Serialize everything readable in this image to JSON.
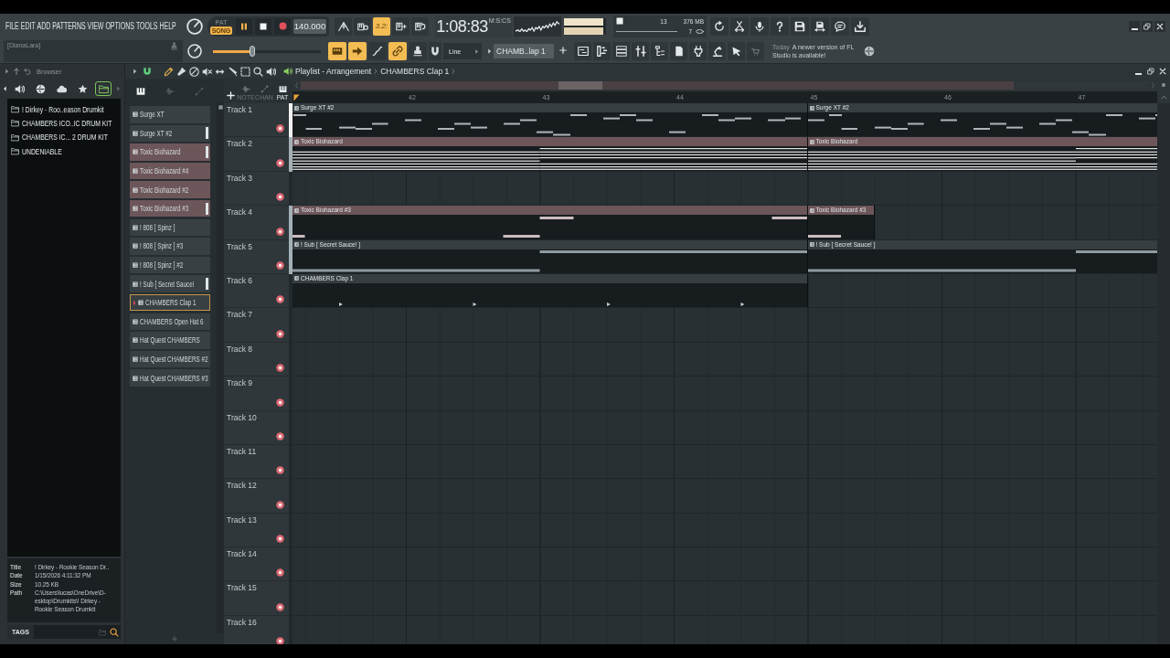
{
  "menu": [
    "FILE",
    "EDIT",
    "ADD",
    "PATTERNS",
    "VIEW",
    "OPTIONS",
    "TOOLS",
    "HELP"
  ],
  "transport": {
    "modes": [
      {
        "label": "PAT",
        "selected": false
      },
      {
        "label": "SONG",
        "selected": true
      }
    ],
    "tempo": "140.000"
  },
  "record_toggles": [
    {
      "on": false
    },
    {
      "on": false
    },
    {
      "on": true,
      "label": "3.2:"
    },
    {
      "on": false
    },
    {
      "on": false
    }
  ],
  "time": {
    "value": "1:08:83",
    "unit": "M:S:CS"
  },
  "output_meter": {
    "level": 0.94
  },
  "monitor": {
    "cpu": "13",
    "memory": "376 MB",
    "polyphony": "7"
  },
  "hint": "[DianaLara]",
  "main_slider": {
    "level": 0.36
  },
  "edit_toggles": [
    {
      "on": true
    },
    {
      "on": true
    },
    {
      "on": false
    },
    {
      "on": true
    },
    {
      "on": false
    },
    {
      "on": false
    }
  ],
  "snap": "Line",
  "pattern_selector": "CHAMB..lap 1",
  "news": {
    "date": "Today",
    "message": "A newer version of FL Studio is available!"
  },
  "browser": {
    "title": "Browser",
    "tabs": [
      {
        "selected": false
      },
      {
        "selected": false
      },
      {
        "selected": false
      },
      {
        "selected": false
      },
      {
        "selected": true
      }
    ],
    "folders": [
      "! Dirkey - Roo..eason Drumkit",
      "CHAMBERS ICO..IC DRUM KIT",
      "CHAMBERS IC... 2 DRUM KIT",
      "UNDENIABLE"
    ],
    "info": [
      {
        "label": "Title",
        "value": "! Dirkey - Rookie Season Dr.."
      },
      {
        "label": "Date",
        "value": "1/15/2026 4:11:32 PM"
      },
      {
        "label": "Size",
        "value": "10.25 KB"
      },
      {
        "label": "Path",
        "value": "C:\\Users\\lucas\\OneDrive\\D-\nesktop\\Drumkits\\! Dirkey -\nRookie Season Drumkit"
      }
    ],
    "tags": "TAGS"
  },
  "playlist": {
    "title": "Playlist - Arrangement",
    "current_pattern": "CHAMBERS Clap 1",
    "picker_tabs": [
      {
        "label": "NOTE",
        "selected": false
      },
      {
        "label": "CHAN",
        "selected": false
      },
      {
        "label": "PAT",
        "selected": true
      }
    ],
    "patterns": [
      {
        "name": "Surge XT",
        "color": "#394044",
        "selected": false,
        "flagged": false
      },
      {
        "name": "Surge XT #2",
        "color": "#394044",
        "selected": false,
        "flagged": true
      },
      {
        "name": "Toxic Biohazard",
        "color": "#6c5659",
        "selected": false,
        "flagged": true
      },
      {
        "name": "Toxic Biohazard #4",
        "color": "#6c5659",
        "selected": false,
        "flagged": false
      },
      {
        "name": "Toxic Biohazard #2",
        "color": "#6c5659",
        "selected": false,
        "flagged": false
      },
      {
        "name": "Toxic Biohazard #3",
        "color": "#6c5659",
        "selected": false,
        "flagged": true
      },
      {
        "name": "! 808 [ Spinz ]",
        "color": "#394044",
        "selected": false,
        "flagged": false
      },
      {
        "name": "! 808 [ Spinz ] #3",
        "color": "#394044",
        "selected": false,
        "flagged": false
      },
      {
        "name": "! 808 [ Spinz ] #2",
        "color": "#394044",
        "selected": false,
        "flagged": false
      },
      {
        "name": "! Sub [ Secret Sauce!",
        "color": "#394044",
        "selected": false,
        "flagged": true
      },
      {
        "name": "CHAMBERS Clap 1",
        "color": "#394044",
        "selected": true,
        "flagged": false
      },
      {
        "name": "CHAMBERS Open Hat 6",
        "color": "#394044",
        "selected": false,
        "flagged": false
      },
      {
        "name": "Hat Quest CHAMBERS",
        "color": "#394044",
        "selected": false,
        "flagged": false
      },
      {
        "name": "Hat Quest CHAMBERS #2",
        "color": "#394044",
        "selected": false,
        "flagged": false
      },
      {
        "name": "Hat Quest CHAMBERS #3",
        "color": "#394044",
        "selected": false,
        "flagged": false
      }
    ],
    "ruler": [
      "42",
      "43",
      "44",
      "45",
      "46",
      "47"
    ],
    "tracks": [
      {
        "name": "Track 1",
        "on": true,
        "color": "#f2f2f2",
        "clips": [
          {
            "name": "Surge XT #2",
            "kind": "melody",
            "color": "#363e42",
            "cut_left": true,
            "cut_right": false
          },
          {
            "name": "Surge XT #2",
            "kind": "melody",
            "color": "#363e42",
            "cut_left": false,
            "cut_right": true
          }
        ]
      },
      {
        "name": "Track 2",
        "on": true,
        "color": "#a3b0b6",
        "clips": [
          {
            "name": "Toxic Biohazard",
            "kind": "chords",
            "color": "#6c5659",
            "cut_left": true,
            "cut_right": false
          },
          {
            "name": "Toxic Biohazard",
            "kind": "chords",
            "color": "#6c5659",
            "cut_left": false,
            "cut_right": true
          }
        ]
      },
      {
        "name": "Track 3",
        "on": true
      },
      {
        "name": "Track 4",
        "on": true,
        "color": "#a3b0b6",
        "clips": [
          {
            "name": "Toxic Biohazard #3",
            "kind": "blocks",
            "color": "#6c5659",
            "cut_left": true,
            "cut_right": false
          },
          {
            "name": "Toxic Biohazard #3",
            "kind": "blocks",
            "color": "#6c5659",
            "cut_left": false,
            "cut_right": false
          }
        ]
      },
      {
        "name": "Track 5",
        "on": true,
        "color": "#a3b0b6",
        "clips": [
          {
            "name": "! Sub [ Secret Sauce! ]",
            "kind": "bass",
            "color": "#363e42",
            "cut_left": true,
            "cut_right": false
          },
          {
            "name": "! Sub [ Secret Sauce! ]",
            "kind": "bass",
            "color": "#363e42",
            "cut_left": false,
            "cut_right": true
          }
        ]
      },
      {
        "name": "Track 6",
        "on": true,
        "clips": [
          {
            "name": "CHAMBERS Clap 1",
            "kind": "hits",
            "color": "#363e42",
            "cut_left": true,
            "cut_right": false
          }
        ]
      },
      {
        "name": "Track 7",
        "on": true
      },
      {
        "name": "Track 8",
        "on": true
      },
      {
        "name": "Track 9",
        "on": true
      },
      {
        "name": "Track 10",
        "on": true
      },
      {
        "name": "Track 11",
        "on": true
      },
      {
        "name": "Track 12",
        "on": true
      },
      {
        "name": "Track 13",
        "on": true
      },
      {
        "name": "Track 14",
        "on": true
      },
      {
        "name": "Track 15",
        "on": true
      },
      {
        "name": "Track 16",
        "on": true
      }
    ]
  }
}
